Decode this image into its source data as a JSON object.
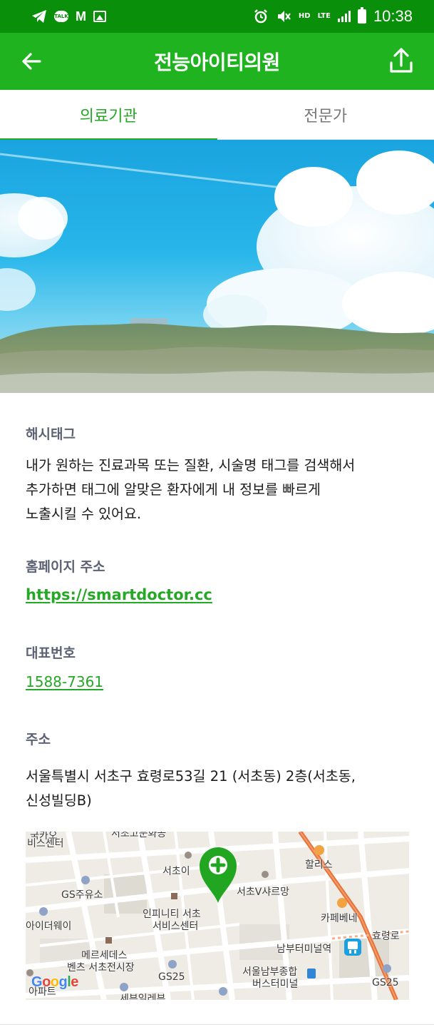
{
  "status_bar": {
    "time": "10:38",
    "talk_badge": "TALK",
    "gmail_icon": "M",
    "hd_label": "HD",
    "lte_label": "LTE",
    "icons": [
      "telegram-icon",
      "kakaotalk-icon",
      "gmail-icon",
      "gallery-icon",
      "alarm-icon",
      "mute-icon",
      "hd-voice-icon",
      "lte-icon",
      "signal-icon",
      "battery-icon"
    ]
  },
  "app_bar": {
    "title": "전능아이티의원",
    "back_icon": "arrow-left-icon",
    "share_icon": "share-upload-icon"
  },
  "tabs": [
    {
      "label": "의료기관",
      "active": true
    },
    {
      "label": "전문가",
      "active": false
    }
  ],
  "sections": {
    "hashtag": {
      "label": "해시태그",
      "lines": [
        "내가 원하는 진료과목 또는 질환, 시술명 태그를 검색해서",
        "추가하면 태그에 알맞은 환자에게 내 정보를 빠르게",
        "노출시킬 수 있어요."
      ]
    },
    "homepage": {
      "label": "홈페이지 주소",
      "url": "https://smartdoctor.cc"
    },
    "phone": {
      "label": "대표번호",
      "number": "1588-7361"
    },
    "address": {
      "label": "주소",
      "lines": [
        "서울특별시 서초구 효령로53길 21 (서초동) 2층(서초동,",
        "신성빌딩B)"
      ]
    }
  },
  "map": {
    "labels": {
      "top_left_1": "국카오",
      "top_left_2": "비스센터",
      "top_center": "서초고문화공",
      "seocho_i": "서초이",
      "gs_gas": "GS주유소",
      "infinity_1": "인피니티 서초",
      "infinity_2": "서비스센터",
      "ida_way": "아이더웨이",
      "mercedes_1": "메르세데스",
      "mercedes_2": "벤츠 서초전시장",
      "gs25_center": "GS25",
      "apt": "아파트",
      "bottom_center": "세븐일레븐",
      "seocho_v": "서초V샤르망",
      "hollys": "할리스",
      "cafe_bene": "카페베네",
      "hyoryeong_ro": "효령로",
      "nambu_station": "남부터미널역",
      "bus_terminal_1": "서울남부종합",
      "bus_terminal_2": "버스터미널",
      "gs25_right": "GS25"
    },
    "pin_icon": "hospital-plus-marker-icon",
    "subway_icon": "subway-icon",
    "logo": "Google",
    "colors": {
      "road_main": "#e8733a",
      "pin": "#22a622",
      "block": "#dedbd3"
    }
  },
  "colors": {
    "status_bar": "#0a8f0a",
    "app_bar": "#1fb41f",
    "accent": "#25a825",
    "label_gray": "#5c6273"
  }
}
